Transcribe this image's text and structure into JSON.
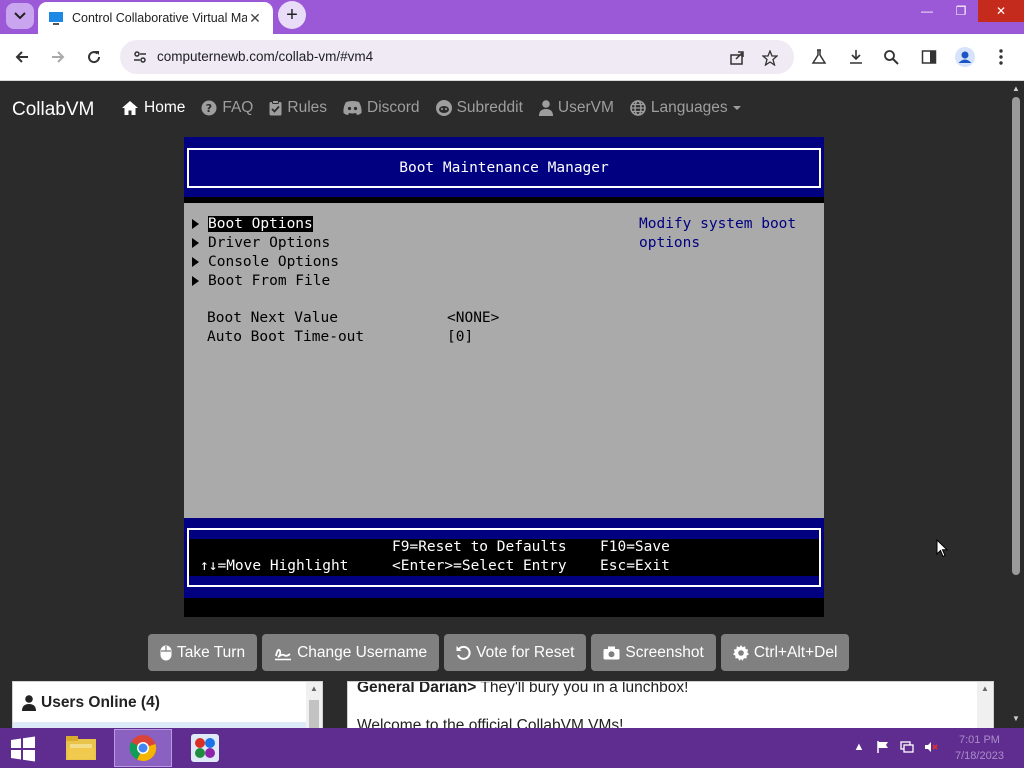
{
  "browser": {
    "tab_title": "Control Collaborative Virtual Ma",
    "url": "computernewb.com/collab-vm/#vm4",
    "new_tab_symbol": "+",
    "tab_close_symbol": "✕"
  },
  "site": {
    "brand": "CollabVM",
    "nav": [
      {
        "label": "Home",
        "icon": "home-icon"
      },
      {
        "label": "FAQ",
        "icon": "question-circle-icon"
      },
      {
        "label": "Rules",
        "icon": "clipboard-check-icon"
      },
      {
        "label": "Discord",
        "icon": "discord-icon"
      },
      {
        "label": "Subreddit",
        "icon": "reddit-icon"
      },
      {
        "label": "UserVM",
        "icon": "user-icon"
      },
      {
        "label": "Languages",
        "icon": "globe-icon"
      }
    ]
  },
  "bios": {
    "title": "Boot Maintenance Manager",
    "menu": [
      "Boot Options",
      "Driver Options",
      "Console Options",
      "Boot From File"
    ],
    "help": "Modify system boot options",
    "values": [
      {
        "label": "Boot Next Value",
        "value": "<NONE>"
      },
      {
        "label": "Auto Boot Time-out",
        "value": "[0]"
      }
    ],
    "footer": {
      "reset": "F9=Reset to Defaults",
      "save": "F10=Save",
      "move": "↑↓=Move Highlight",
      "select": "<Enter>=Select Entry",
      "exit": "Esc=Exit"
    }
  },
  "buttons": {
    "take_turn": "Take Turn",
    "change_username": "Change Username",
    "vote_reset": "Vote for Reset",
    "screenshot": "Screenshot",
    "cad": "Ctrl+Alt+Del"
  },
  "users": {
    "title": "Users Online (4)"
  },
  "chat": {
    "messages": [
      {
        "user": "General Darian>",
        "text": " They'll bury you in a lunchbox!"
      },
      {
        "user": "",
        "text": "Welcome to the official CollabVM VMs!"
      }
    ]
  },
  "taskbar": {
    "time": "7:01 PM",
    "date": "7/18/2023"
  },
  "colors": {
    "tabbar": "#9b59d8",
    "bios_blue": "#000080",
    "bios_gray": "#aaaaaa",
    "button_gray": "#808080"
  }
}
